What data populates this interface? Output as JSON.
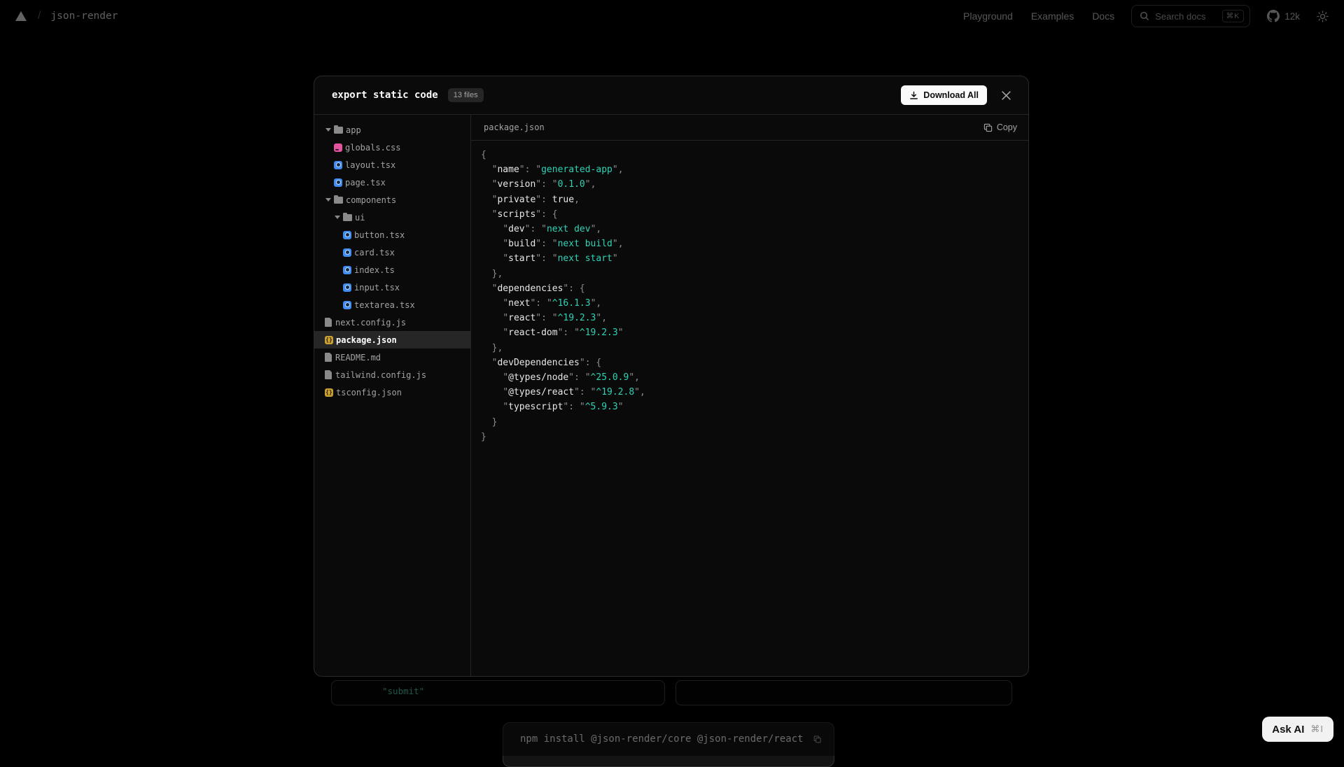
{
  "navbar": {
    "brand": "json-render",
    "slash": "/",
    "links": [
      "Playground",
      "Examples",
      "Docs"
    ],
    "search": {
      "placeholder": "Search docs",
      "shortcut": "⌘K"
    },
    "github_stars": "12k"
  },
  "modal": {
    "title": "export static code",
    "files_badge": "13 files",
    "download_label": "Download All",
    "file_tree": [
      {
        "name": "app",
        "type": "folder",
        "depth": 0,
        "expanded": true
      },
      {
        "name": "globals.css",
        "type": "css",
        "depth": 1
      },
      {
        "name": "layout.tsx",
        "type": "tsx",
        "depth": 1
      },
      {
        "name": "page.tsx",
        "type": "tsx",
        "depth": 1
      },
      {
        "name": "components",
        "type": "folder",
        "depth": 0,
        "expanded": true
      },
      {
        "name": "ui",
        "type": "folder",
        "depth": 1,
        "expanded": true
      },
      {
        "name": "button.tsx",
        "type": "tsx",
        "depth": 2
      },
      {
        "name": "card.tsx",
        "type": "tsx",
        "depth": 2
      },
      {
        "name": "index.ts",
        "type": "tsx",
        "depth": 2
      },
      {
        "name": "input.tsx",
        "type": "tsx",
        "depth": 2
      },
      {
        "name": "textarea.tsx",
        "type": "tsx",
        "depth": 2
      },
      {
        "name": "next.config.js",
        "type": "file",
        "depth": 0
      },
      {
        "name": "package.json",
        "type": "json",
        "depth": 0,
        "selected": true
      },
      {
        "name": "README.md",
        "type": "file",
        "depth": 0
      },
      {
        "name": "tailwind.config.js",
        "type": "file",
        "depth": 0
      },
      {
        "name": "tsconfig.json",
        "type": "json",
        "depth": 0
      }
    ],
    "viewer": {
      "filename": "package.json",
      "copy_label": "Copy"
    },
    "code_lines": [
      [
        [
          "p",
          "{"
        ]
      ],
      [
        [
          "p",
          "  "
        ],
        [
          "q",
          "\""
        ],
        [
          "k",
          "name"
        ],
        [
          "q",
          "\""
        ],
        [
          "p",
          ": "
        ],
        [
          "q",
          "\""
        ],
        [
          "v",
          "generated-app"
        ],
        [
          "q",
          "\""
        ],
        [
          "p",
          ","
        ]
      ],
      [
        [
          "p",
          "  "
        ],
        [
          "q",
          "\""
        ],
        [
          "k",
          "version"
        ],
        [
          "q",
          "\""
        ],
        [
          "p",
          ": "
        ],
        [
          "q",
          "\""
        ],
        [
          "v",
          "0.1.0"
        ],
        [
          "q",
          "\""
        ],
        [
          "p",
          ","
        ]
      ],
      [
        [
          "p",
          "  "
        ],
        [
          "q",
          "\""
        ],
        [
          "k",
          "private"
        ],
        [
          "q",
          "\""
        ],
        [
          "p",
          ": "
        ],
        [
          "b",
          "true"
        ],
        [
          "p",
          ","
        ]
      ],
      [
        [
          "p",
          "  "
        ],
        [
          "q",
          "\""
        ],
        [
          "k",
          "scripts"
        ],
        [
          "q",
          "\""
        ],
        [
          "p",
          ": {"
        ]
      ],
      [
        [
          "p",
          "    "
        ],
        [
          "q",
          "\""
        ],
        [
          "k",
          "dev"
        ],
        [
          "q",
          "\""
        ],
        [
          "p",
          ": "
        ],
        [
          "q",
          "\""
        ],
        [
          "v",
          "next dev"
        ],
        [
          "q",
          "\""
        ],
        [
          "p",
          ","
        ]
      ],
      [
        [
          "p",
          "    "
        ],
        [
          "q",
          "\""
        ],
        [
          "k",
          "build"
        ],
        [
          "q",
          "\""
        ],
        [
          "p",
          ": "
        ],
        [
          "q",
          "\""
        ],
        [
          "v",
          "next build"
        ],
        [
          "q",
          "\""
        ],
        [
          "p",
          ","
        ]
      ],
      [
        [
          "p",
          "    "
        ],
        [
          "q",
          "\""
        ],
        [
          "k",
          "start"
        ],
        [
          "q",
          "\""
        ],
        [
          "p",
          ": "
        ],
        [
          "q",
          "\""
        ],
        [
          "v",
          "next start"
        ],
        [
          "q",
          "\""
        ]
      ],
      [
        [
          "p",
          "  },"
        ]
      ],
      [
        [
          "p",
          "  "
        ],
        [
          "q",
          "\""
        ],
        [
          "k",
          "dependencies"
        ],
        [
          "q",
          "\""
        ],
        [
          "p",
          ": {"
        ]
      ],
      [
        [
          "p",
          "    "
        ],
        [
          "q",
          "\""
        ],
        [
          "k",
          "next"
        ],
        [
          "q",
          "\""
        ],
        [
          "p",
          ": "
        ],
        [
          "q",
          "\""
        ],
        [
          "v",
          "^16.1.3"
        ],
        [
          "q",
          "\""
        ],
        [
          "p",
          ","
        ]
      ],
      [
        [
          "p",
          "    "
        ],
        [
          "q",
          "\""
        ],
        [
          "k",
          "react"
        ],
        [
          "q",
          "\""
        ],
        [
          "p",
          ": "
        ],
        [
          "q",
          "\""
        ],
        [
          "v",
          "^19.2.3"
        ],
        [
          "q",
          "\""
        ],
        [
          "p",
          ","
        ]
      ],
      [
        [
          "p",
          "    "
        ],
        [
          "q",
          "\""
        ],
        [
          "k",
          "react-dom"
        ],
        [
          "q",
          "\""
        ],
        [
          "p",
          ": "
        ],
        [
          "q",
          "\""
        ],
        [
          "v",
          "^19.2.3"
        ],
        [
          "q",
          "\""
        ]
      ],
      [
        [
          "p",
          "  },"
        ]
      ],
      [
        [
          "p",
          "  "
        ],
        [
          "q",
          "\""
        ],
        [
          "k",
          "devDependencies"
        ],
        [
          "q",
          "\""
        ],
        [
          "p",
          ": {"
        ]
      ],
      [
        [
          "p",
          "    "
        ],
        [
          "q",
          "\""
        ],
        [
          "k",
          "@types/node"
        ],
        [
          "q",
          "\""
        ],
        [
          "p",
          ": "
        ],
        [
          "q",
          "\""
        ],
        [
          "v",
          "^25.0.9"
        ],
        [
          "q",
          "\""
        ],
        [
          "p",
          ","
        ]
      ],
      [
        [
          "p",
          "    "
        ],
        [
          "q",
          "\""
        ],
        [
          "k",
          "@types/react"
        ],
        [
          "q",
          "\""
        ],
        [
          "p",
          ": "
        ],
        [
          "q",
          "\""
        ],
        [
          "v",
          "^19.2.8"
        ],
        [
          "q",
          "\""
        ],
        [
          "p",
          ","
        ]
      ],
      [
        [
          "p",
          "    "
        ],
        [
          "q",
          "\""
        ],
        [
          "k",
          "typescript"
        ],
        [
          "q",
          "\""
        ],
        [
          "p",
          ": "
        ],
        [
          "q",
          "\""
        ],
        [
          "v",
          "^5.9.3"
        ],
        [
          "q",
          "\""
        ]
      ],
      [
        [
          "p",
          "  }"
        ]
      ],
      [
        [
          "p",
          "}"
        ]
      ]
    ]
  },
  "background": {
    "snippet_text": "\"submit\"",
    "install_command": "npm install @json-render/core @json-render/react"
  },
  "ask_ai": {
    "label": "Ask AI",
    "shortcut": "⌘I"
  },
  "colors": {
    "accent_teal": "#2ed3b7",
    "tsx_icon": "#3f8cf3",
    "css_icon": "#e5549f",
    "json_icon": "#c9a032",
    "selected_row_bg": "#262626"
  }
}
